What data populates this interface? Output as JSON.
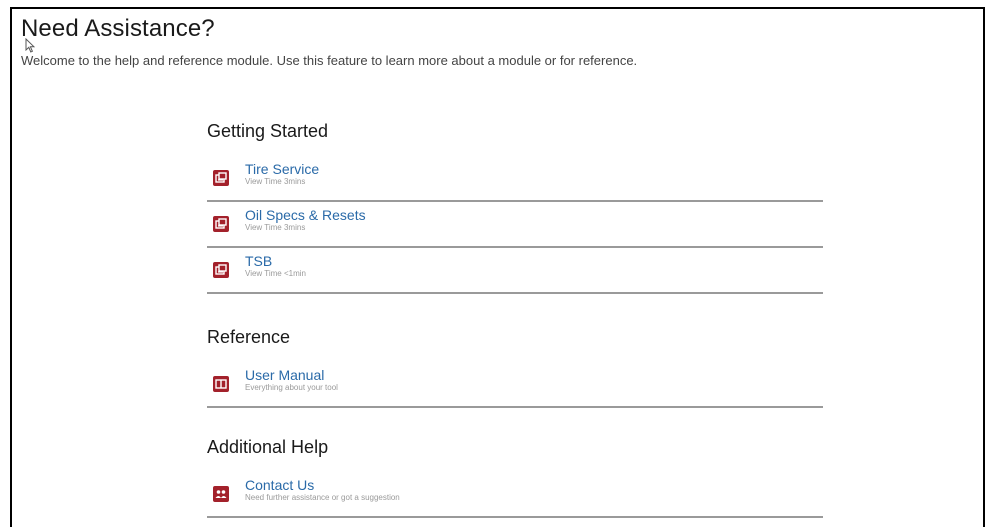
{
  "header": {
    "title": "Need Assistance?",
    "subtitle": "Welcome to the help and reference module. Use this feature to learn more about a module or for reference."
  },
  "sections": [
    {
      "title": "Getting Started",
      "items": [
        {
          "label": "Tire Service",
          "sub": "View Time 3mins",
          "icon": "video-tutorial-icon"
        },
        {
          "label": "Oil Specs & Resets",
          "sub": "View Time 3mins",
          "icon": "video-tutorial-icon"
        },
        {
          "label": "TSB",
          "sub": "View Time <1min",
          "icon": "video-tutorial-icon"
        }
      ]
    },
    {
      "title": "Reference",
      "items": [
        {
          "label": "User Manual",
          "sub": "Everything about your tool",
          "icon": "book-icon"
        }
      ]
    },
    {
      "title": "Additional Help",
      "items": [
        {
          "label": "Contact Us",
          "sub": "Need further assistance or got a suggestion",
          "icon": "contact-icon"
        }
      ]
    }
  ],
  "colors": {
    "icon_bg": "#a3212b",
    "link": "#2a6aa8",
    "divider": "#9a9a9a"
  }
}
